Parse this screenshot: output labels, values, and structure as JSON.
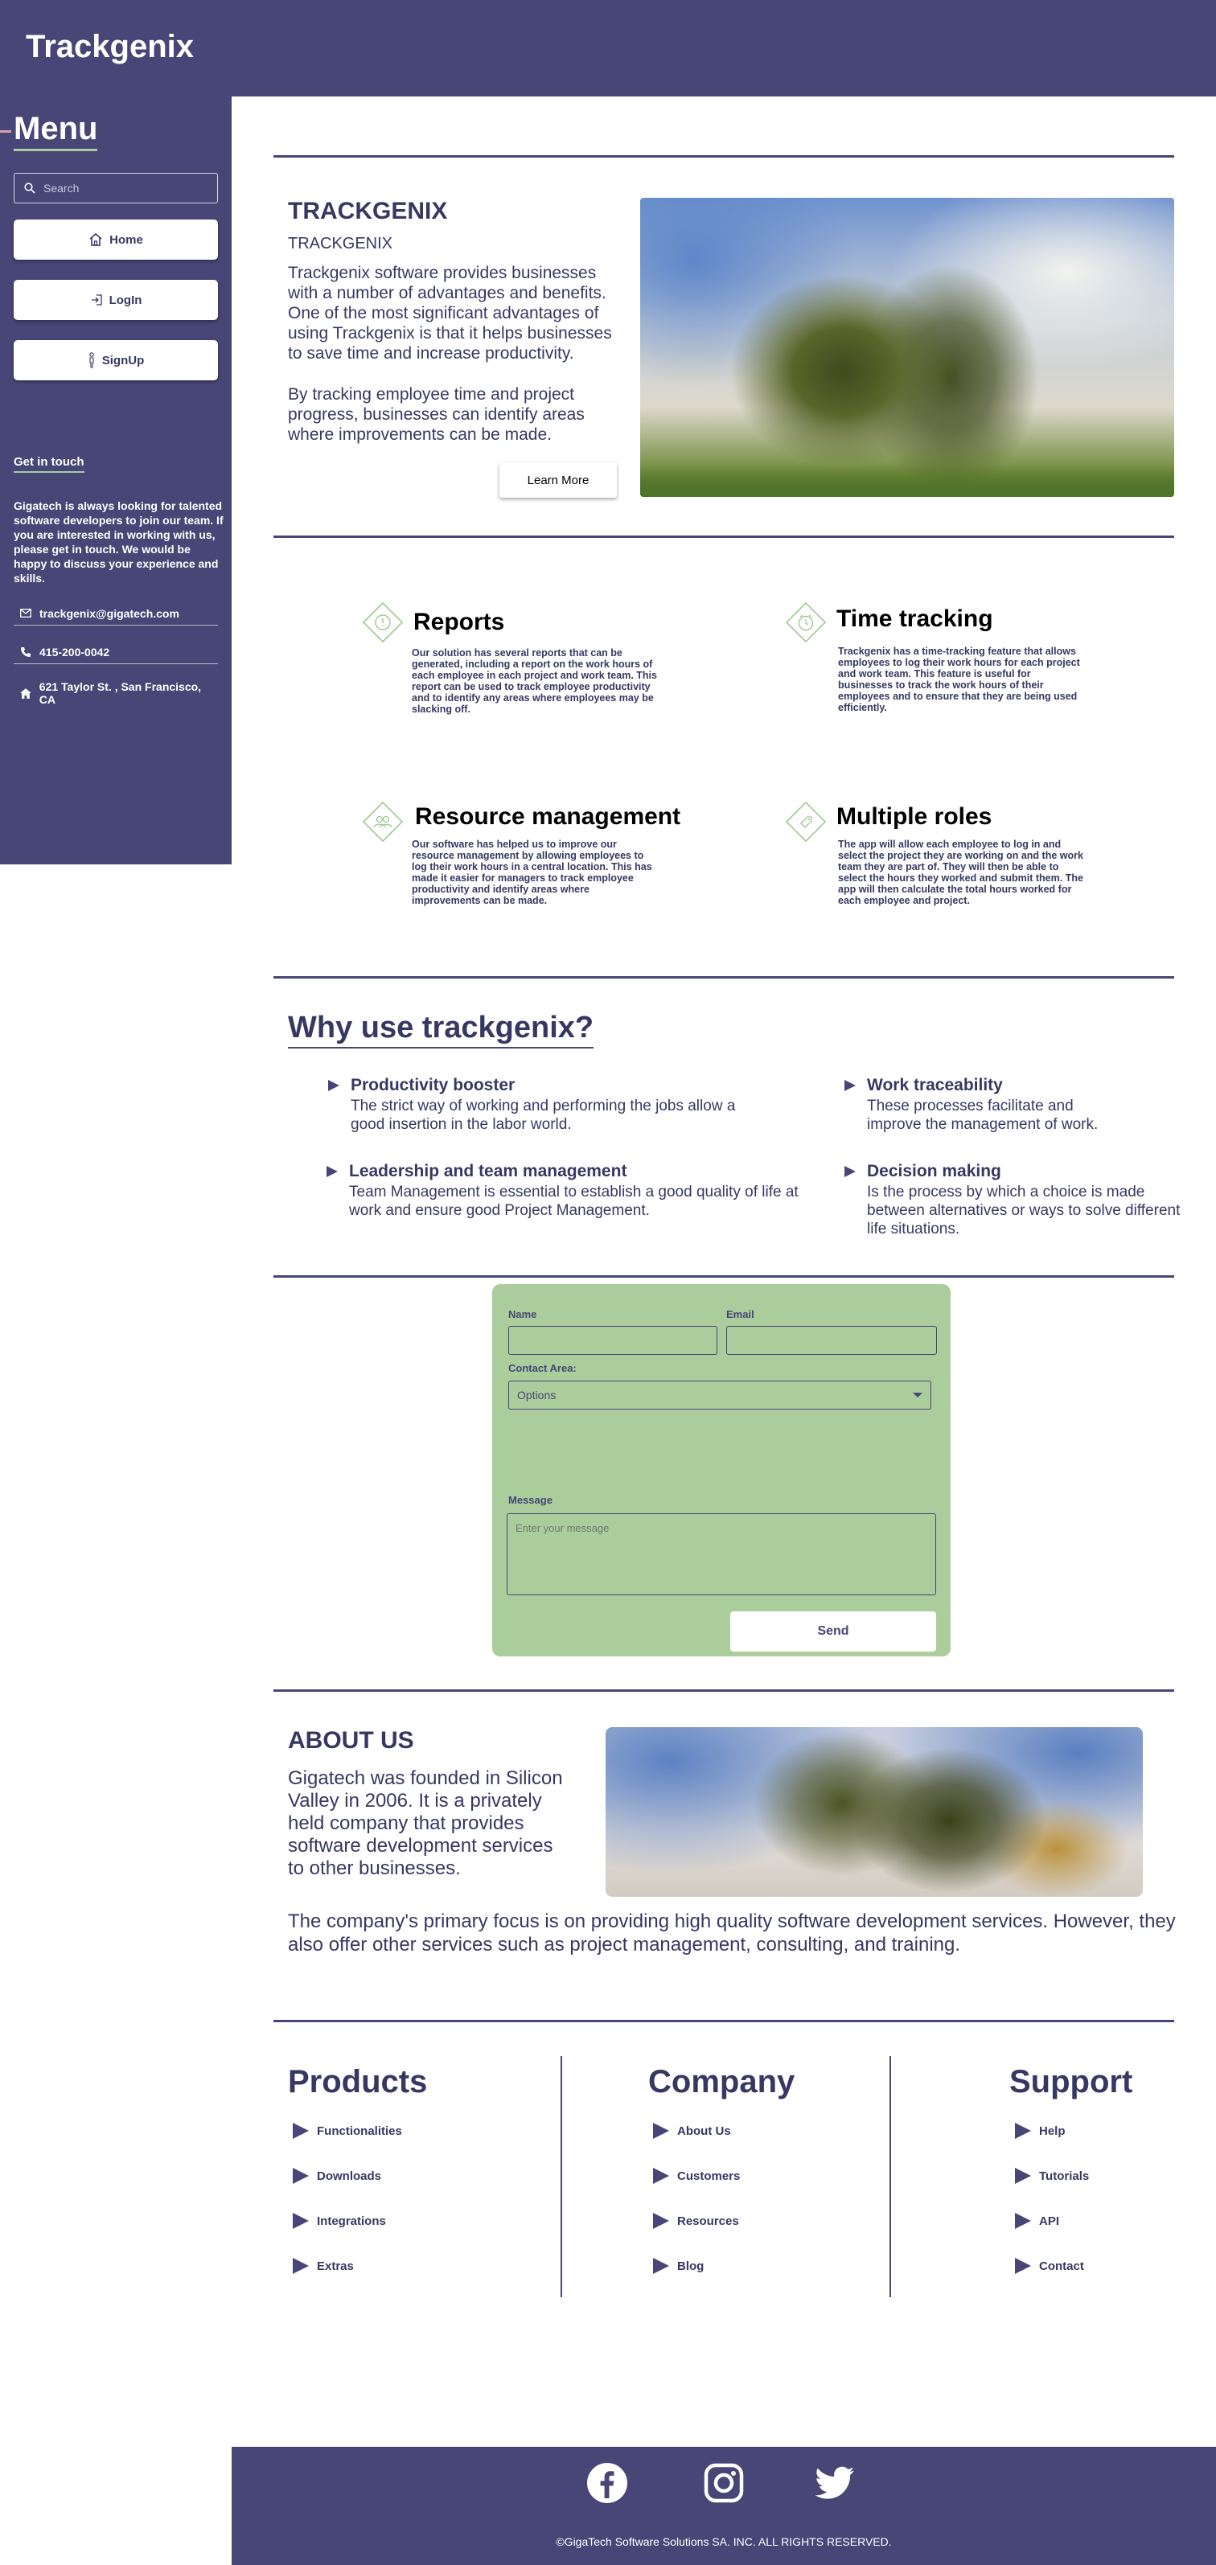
{
  "header": {
    "brand": "Trackgenix"
  },
  "sidebar": {
    "menu_title": "Menu",
    "search_placeholder": "Search",
    "nav": [
      {
        "label": "Home",
        "icon": "home-icon"
      },
      {
        "label": "LogIn",
        "icon": "login-icon"
      },
      {
        "label": "SignUp",
        "icon": "person-icon"
      }
    ],
    "get_in_touch": "Get in touch",
    "touch_text": "Gigatech is always looking for talented software developers to join our team. If you are interested in working with us, please get in touch. We would be happy to discuss your experience and skills.",
    "email": "trackgenix@gigatech.com",
    "phone": "415-200-0042",
    "address": "621 Taylor St. , San Francisco, CA"
  },
  "hero": {
    "title": "TRACKGENIX",
    "subtitle": "TRACKGENIX",
    "p1": "Trackgenix software provides businesses with a number of advantages and benefits. One of the most significant advantages of using Trackgenix is that it helps businesses to save time and increase productivity.",
    "p2": "By tracking employee time and project progress, businesses can identify areas where improvements can be made.",
    "button": "Learn More"
  },
  "features": [
    {
      "title": "Reports",
      "icon": "alert-circle-icon",
      "text": "Our solution has several reports that can be generated, including a report on the work hours of each employee in each project and work team. This report can be used to track employee productivity and to identify any areas where employees may be slacking off."
    },
    {
      "title": "Time tracking",
      "icon": "clock-icon",
      "text": "Trackgenix has a time-tracking feature that allows employees to log their work hours for each project and work team. This feature is useful for businesses to track the work hours of their employees and to ensure that they are being used efficiently."
    },
    {
      "title": "Resource management",
      "icon": "users-icon",
      "text": "Our software has helped us to improve our resource management by allowing employees to log their work hours in a central location. This has made it easier for managers to track employee productivity and identify areas where improvements can be made."
    },
    {
      "title": "Multiple roles",
      "icon": "tag-icon",
      "text": "The app will allow each employee to log in and select the project they are working on and the work team they are part of. They will then be able to select the hours they worked and submit them. The app will then calculate the total hours worked for each employee and project."
    }
  ],
  "why": {
    "title": "Why use trackgenix?",
    "items": [
      {
        "heading": "Productivity booster",
        "text": "The strict way of working and performing the jobs allow a good insertion in the labor world."
      },
      {
        "heading": "Work traceability",
        "text": "These processes facilitate and improve the management of work."
      },
      {
        "heading": "Leadership and team management",
        "text": "Team Management is essential to establish a good quality of life at work and ensure good Project Management."
      },
      {
        "heading": "Decision making",
        "text": "Is the process by which a choice is made between alternatives or ways to solve different life situations."
      }
    ]
  },
  "form": {
    "name_label": "Name",
    "email_label": "Email",
    "area_label": "Contact Area:",
    "area_value": "Options",
    "message_label": "Message",
    "message_placeholder": "Enter your message",
    "send": "Send"
  },
  "about": {
    "title": "ABOUT US",
    "p1": "Gigatech was founded in Silicon Valley in 2006. It is a privately held company that provides software development services to other businesses.",
    "p2": "The company's primary focus is on providing high quality software development services. However, they also offer other services such as project management, consulting, and training."
  },
  "footer_links": [
    {
      "title": "Products",
      "links": [
        "Functionalities",
        "Downloads",
        "Integrations",
        "Extras"
      ]
    },
    {
      "title": "Company",
      "links": [
        "About Us",
        "Customers",
        "Resources",
        "Blog"
      ]
    },
    {
      "title": "Support",
      "links": [
        "Help",
        "Tutorials",
        "API",
        "Contact"
      ]
    }
  ],
  "footer": {
    "social": [
      "facebook-icon",
      "instagram-icon",
      "twitter-icon"
    ],
    "copyright": "©GigaTech Software Solutions SA. INC. ALL RIGHTS RESERVED."
  },
  "colors": {
    "primary": "#474677",
    "text": "#363862",
    "accent_green": "#abcc9b"
  }
}
